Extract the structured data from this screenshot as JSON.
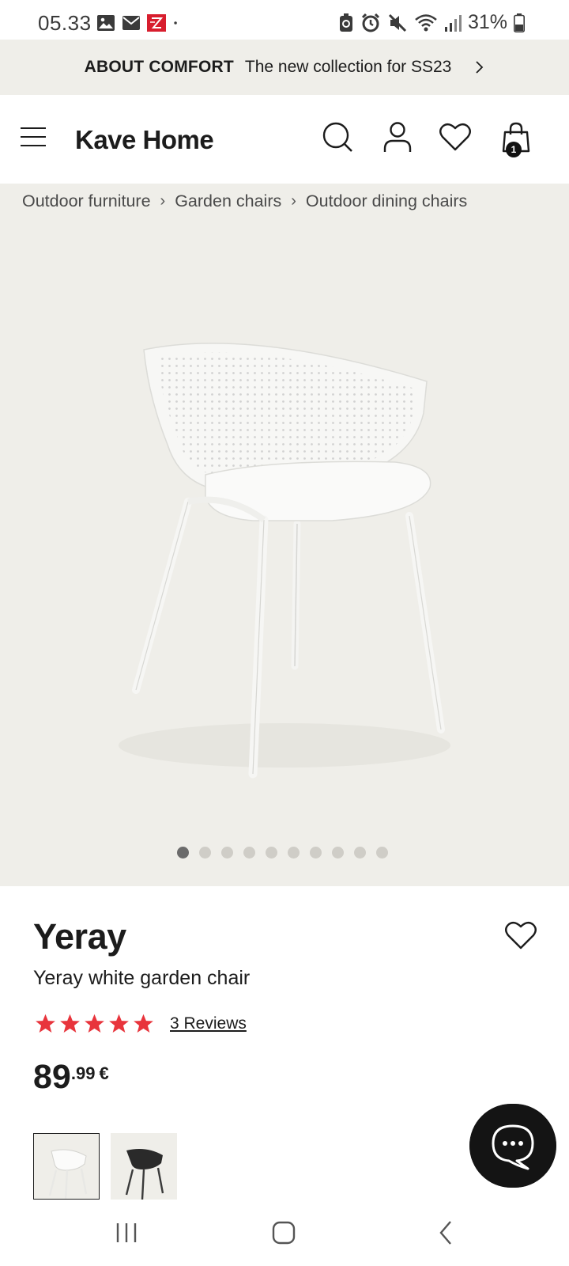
{
  "status_bar": {
    "time": "05.33",
    "battery": "31%",
    "left_icons": [
      "image-icon",
      "mail-icon",
      "app-notification-icon",
      "dot-icon"
    ],
    "right_icons": [
      "battery-saver-icon",
      "alarm-icon",
      "mute-icon",
      "wifi-icon",
      "signal-icon",
      "battery-icon"
    ]
  },
  "promo": {
    "title": "ABOUT COMFORT",
    "text": "The new collection for SS23",
    "chevron": "›"
  },
  "header": {
    "brand": "Kave Home",
    "cart_count": "1",
    "icons": [
      "menu-icon",
      "search-icon",
      "account-icon",
      "wishlist-icon",
      "cart-icon"
    ]
  },
  "breadcrumb": {
    "items": [
      "Outdoor furniture",
      "Garden chairs",
      "Outdoor dining chairs"
    ],
    "separator": "›"
  },
  "gallery": {
    "total_images": 10,
    "active_index": 0
  },
  "product": {
    "name": "Yeray",
    "subtitle": "Yeray white garden chair",
    "rating": 5,
    "rating_max": 5,
    "reviews_label": "3 Reviews",
    "price_int": "89",
    "price_dec": ".99",
    "currency": "€"
  },
  "colors": {
    "accent_star": "#e8343c",
    "hero_bg": "#efeee9",
    "dark": "#141414"
  },
  "thumbnails": [
    {
      "name": "white-chair",
      "selected": true
    },
    {
      "name": "black-chair",
      "selected": false
    }
  ]
}
